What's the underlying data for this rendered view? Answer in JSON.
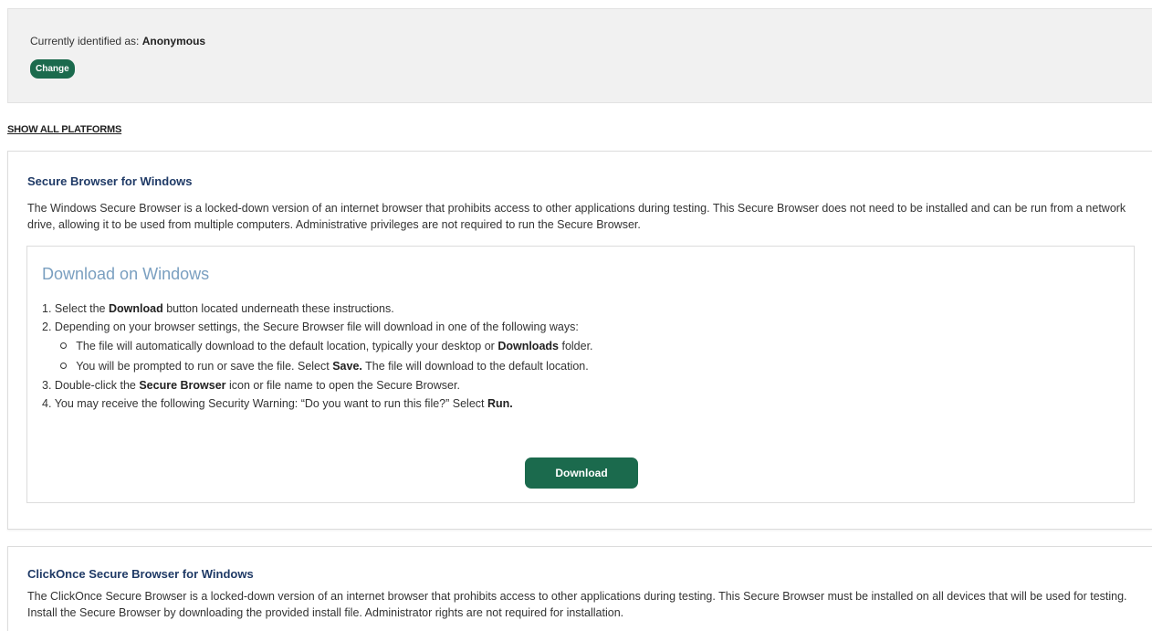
{
  "identity": {
    "prefix": "Currently identified as:",
    "name": "Anonymous",
    "change_label": "Change"
  },
  "show_all_label": "SHOW ALL PLATFORMS",
  "platforms": [
    {
      "title": "Secure Browser for Windows",
      "description": "The Windows Secure Browser is a locked-down version of an internet browser that prohibits access to other applications during testing. This Secure Browser does not need to be installed and can be run from a network drive, allowing it to be used from multiple computers. Administrative privileges are not required to run the Secure Browser.",
      "download": {
        "heading": "Download on Windows",
        "step1": {
          "num": "1.",
          "pre": "Select the",
          "bold": "Download",
          "post": "button located underneath these instructions."
        },
        "step2": {
          "num": "2.",
          "text": "Depending on your browser settings, the Secure Browser file will download in one of the following ways:"
        },
        "step2a": {
          "pre": "The file will automatically download to the default location, typically your desktop or",
          "bold": "Downloads",
          "post": "folder."
        },
        "step2b": {
          "pre": "You will be prompted to run or save the file. Select",
          "bold": "Save.",
          "post": "The file will download to the default location."
        },
        "step3": {
          "num": "3.",
          "pre": "Double-click the",
          "bold": "Secure Browser",
          "post": "icon or file name to open the Secure Browser."
        },
        "step4": {
          "num": "4.",
          "pre": "You may receive the following Security Warning: “Do you want to run this file?” Select",
          "bold": "Run."
        },
        "button_label": "Download"
      }
    },
    {
      "title": "ClickOnce Secure Browser for Windows",
      "description": "The ClickOnce Secure Browser is a locked-down version of an internet browser that prohibits access to other applications during testing. This Secure Browser must be installed on all devices that will be used for testing. Install the Secure Browser by downloading the provided install file. Administrator rights are not required for installation."
    }
  ],
  "colors": {
    "button_green": "#1b6a4d",
    "title_navy": "#1f3a66",
    "heading_blue": "#7a9fc0",
    "panel_gray": "#f1f1f1"
  }
}
